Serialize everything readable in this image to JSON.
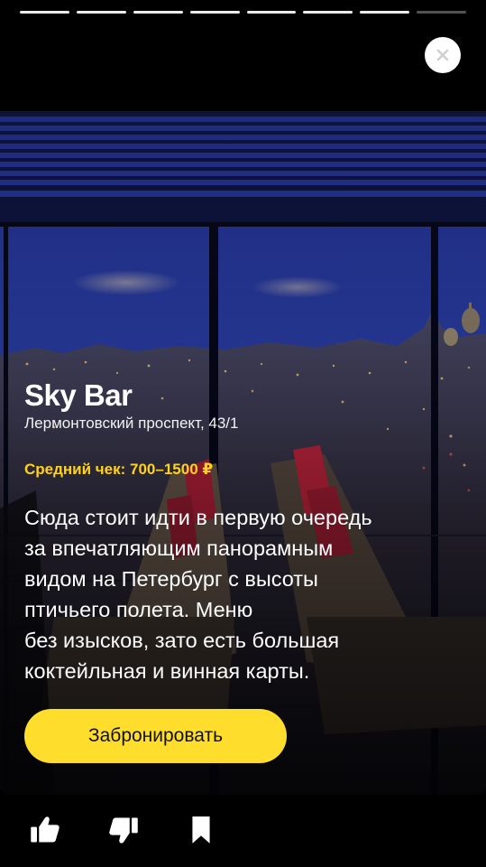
{
  "story": {
    "segments_total": 8,
    "segments_viewed": 7
  },
  "venue": {
    "name": "Sky Bar",
    "address": "Лермонтовский проспект, 43/1",
    "average_check": "Средний чек: 700–1500 ₽",
    "description_lines": [
      "Сюда стоит идти в первую очередь",
      "за впечатляющим панорамным",
      "видом на Петербург с высоты",
      "птичьего полета. Меню",
      "без изысков, зато есть большая",
      "коктейльная и винная карты."
    ]
  },
  "cta": {
    "label": "Забронировать"
  },
  "icons": {
    "close": "close-icon",
    "like": "thumbs-up-icon",
    "dislike": "thumbs-down-icon",
    "bookmark": "bookmark-icon"
  },
  "colors": {
    "accent": "#ffdd2d",
    "price": "#ffd21f",
    "background": "#000000"
  }
}
